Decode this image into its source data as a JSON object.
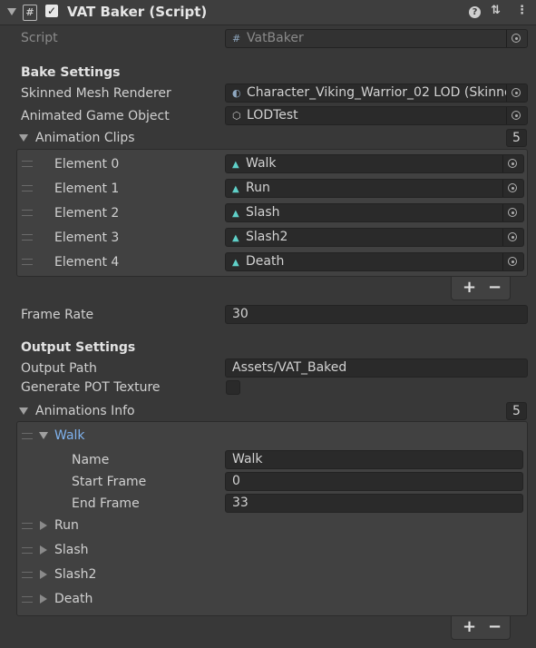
{
  "header": {
    "title": "VAT Baker (Script)",
    "help_icon": "help-icon",
    "preset_icon": "sliders-icon",
    "menu_icon": "kebab-menu-icon"
  },
  "script": {
    "label": "Script",
    "value": "VatBaker"
  },
  "bake": {
    "title": "Bake Settings",
    "smr_label": "Skinned Mesh Renderer",
    "smr_value": "Character_Viking_Warrior_02 LOD (Skinned",
    "ago_label": "Animated Game Object",
    "ago_value": "LODTest",
    "clips_label": "Animation Clips",
    "clips_count": "5",
    "clips": [
      {
        "label": "Element 0",
        "value": "Walk"
      },
      {
        "label": "Element 1",
        "value": "Run"
      },
      {
        "label": "Element 2",
        "value": "Slash"
      },
      {
        "label": "Element 3",
        "value": "Slash2"
      },
      {
        "label": "Element 4",
        "value": "Death"
      }
    ],
    "frame_rate_label": "Frame Rate",
    "frame_rate_value": "30"
  },
  "output": {
    "title": "Output Settings",
    "path_label": "Output Path",
    "path_value": "Assets/VAT_Baked",
    "pot_label": "Generate POT Texture",
    "info_label": "Animations Info",
    "info_count": "5",
    "walk": {
      "label": "Walk",
      "name_label": "Name",
      "name_value": "Walk",
      "start_label": "Start Frame",
      "start_value": "0",
      "end_label": "End Frame",
      "end_value": "33"
    },
    "collapsed": [
      "Run",
      "Slash",
      "Slash2",
      "Death"
    ]
  },
  "buttons": {
    "plus": "+",
    "minus": "−"
  }
}
